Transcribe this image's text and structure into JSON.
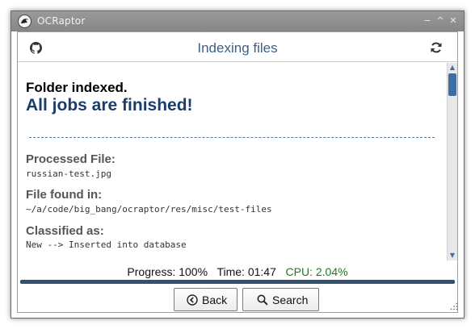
{
  "window": {
    "title": "OCRaptor"
  },
  "header": {
    "title": "Indexing files"
  },
  "status": {
    "line1": "Folder indexed.",
    "line2": "All jobs are finished!"
  },
  "details": {
    "processed_label": "Processed File:",
    "processed_value": "russian-test.jpg",
    "found_label": "File found in:",
    "found_value": "~/a/code/big_bang/ocraptor/res/misc/test-files",
    "classified_label": "Classified as:",
    "classified_value": "New --> Inserted into database"
  },
  "progress": {
    "progress_text": "Progress: 100%",
    "time_text": "Time: 01:47",
    "cpu_text": "CPU: 2.04%",
    "fraction": 1.0
  },
  "buttons": {
    "back": "Back",
    "search": "Search"
  },
  "icons": [
    "app-logo-icon",
    "github-icon",
    "refresh-icon",
    "back-arrow-icon",
    "search-icon",
    "resize-grip-icon"
  ],
  "colors": {
    "accent": "#3d5f86",
    "status": "#1a3d6e",
    "cpu": "#1e7a1e",
    "progress": "#34506f",
    "scroll_thumb": "#3e6da3"
  }
}
